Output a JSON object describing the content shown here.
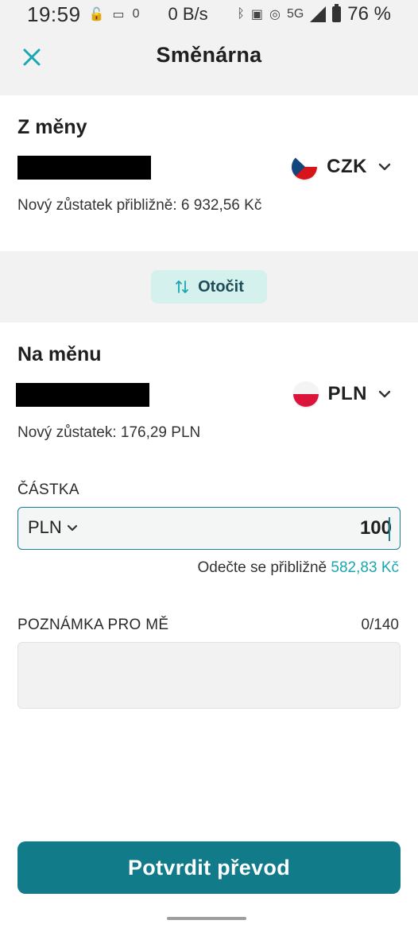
{
  "status_bar": {
    "time": "19:59",
    "notif_count": "0",
    "net_speed": "0 B/s",
    "network": "5G",
    "battery": "76 %"
  },
  "header": {
    "title": "Směnárna",
    "close_icon": "close-icon"
  },
  "from": {
    "title": "Z měny",
    "currency": "CZK",
    "balance_text": "Nový zůstatek přibližně: 6 932,56 Kč"
  },
  "swap": {
    "label": "Otočit",
    "icon": "swap-arrows-icon"
  },
  "to": {
    "title": "Na měnu",
    "currency": "PLN",
    "balance_text": "Nový zůstatek: 176,29 PLN"
  },
  "amount": {
    "label": "ČÁSTKA",
    "currency": "PLN",
    "value": "100",
    "deduct_prefix": "Odečte se přibližně",
    "deduct_value": "582,83 Kč"
  },
  "note": {
    "label": "POZNÁMKA PRO MĚ",
    "counter": "0/140"
  },
  "confirm": {
    "label": "Potvrdit převod"
  },
  "colors": {
    "accent": "#127b8a",
    "accent_light": "#1aa7b0",
    "swap_bg": "#d4f1ee"
  }
}
